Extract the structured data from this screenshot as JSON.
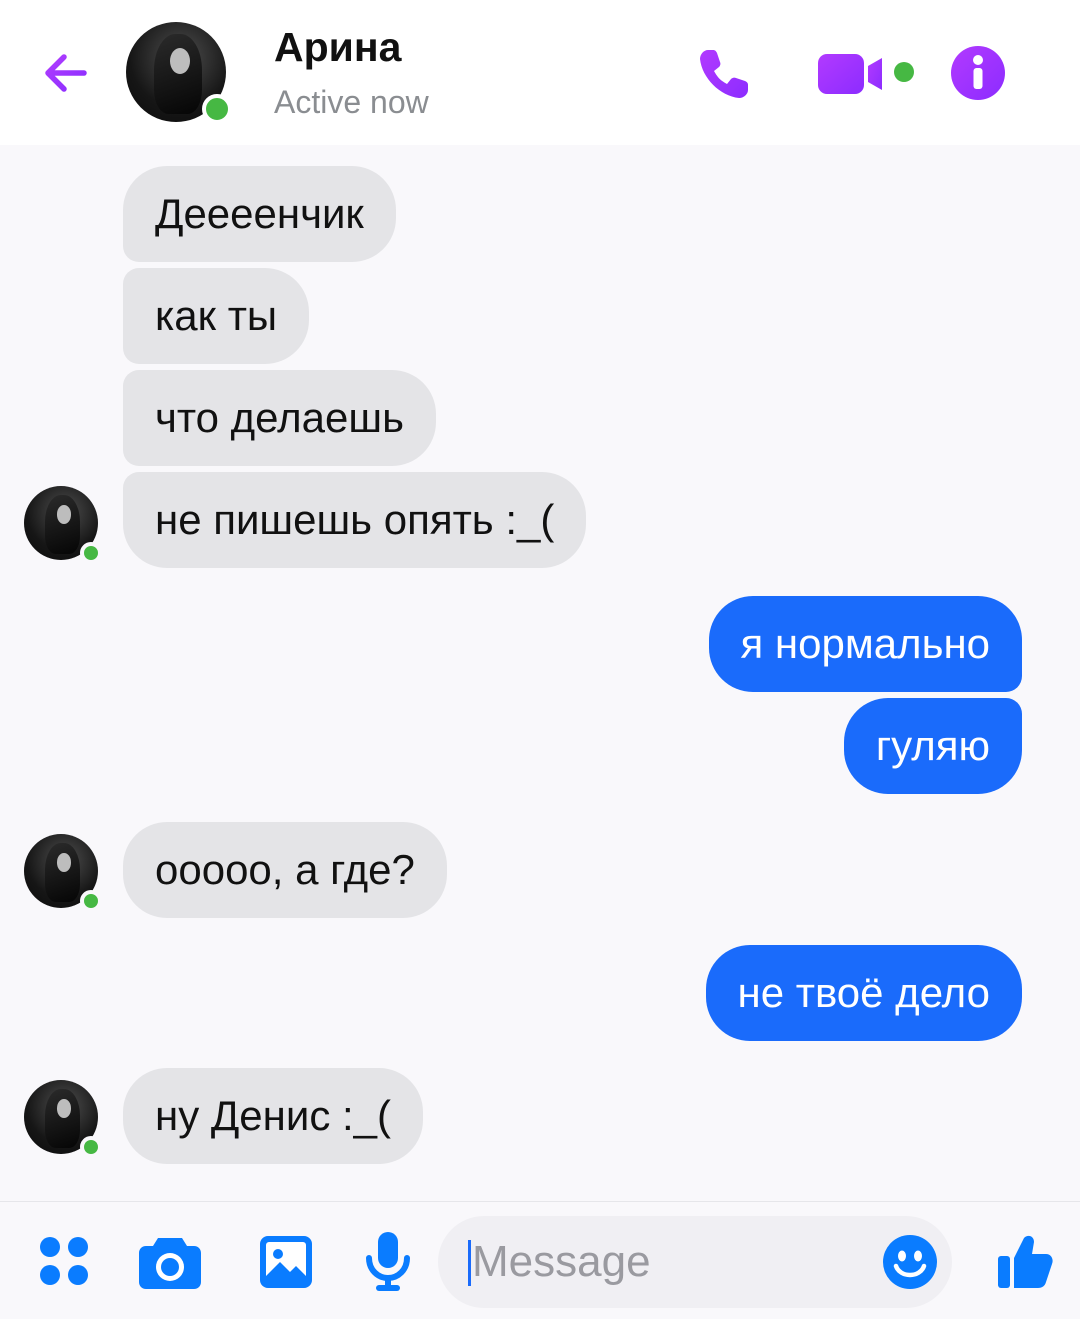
{
  "header": {
    "contact_name": "Арина",
    "status": "Active now"
  },
  "messages": [
    {
      "side": "in",
      "text": "Деееенчик"
    },
    {
      "side": "in",
      "text": "как ты"
    },
    {
      "side": "in",
      "text": "что делаешь"
    },
    {
      "side": "in",
      "text": "не пишешь опять :_("
    },
    {
      "side": "out",
      "text": "я нормально"
    },
    {
      "side": "out",
      "text": "гуляю"
    },
    {
      "side": "in",
      "text": "ооооо, а где?"
    },
    {
      "side": "out",
      "text": "не твоё дело"
    },
    {
      "side": "in",
      "text": "ну Денис :_("
    }
  ],
  "composer": {
    "placeholder": "Message"
  },
  "icons": {
    "back": "arrow-left-icon",
    "call": "phone-icon",
    "video": "video-camera-icon",
    "info": "info-icon",
    "apps": "grid-dots-icon",
    "camera": "camera-icon",
    "gallery": "image-icon",
    "mic": "microphone-icon",
    "emoji": "smiley-icon",
    "like": "thumbs-up-icon"
  },
  "colors": {
    "accent_purple": "#a033ff",
    "outgoing_bubble": "#1a6bfb",
    "incoming_bubble": "#e4e4e7",
    "online_green": "#46b843",
    "toolbar_blue": "#0a7cff"
  }
}
